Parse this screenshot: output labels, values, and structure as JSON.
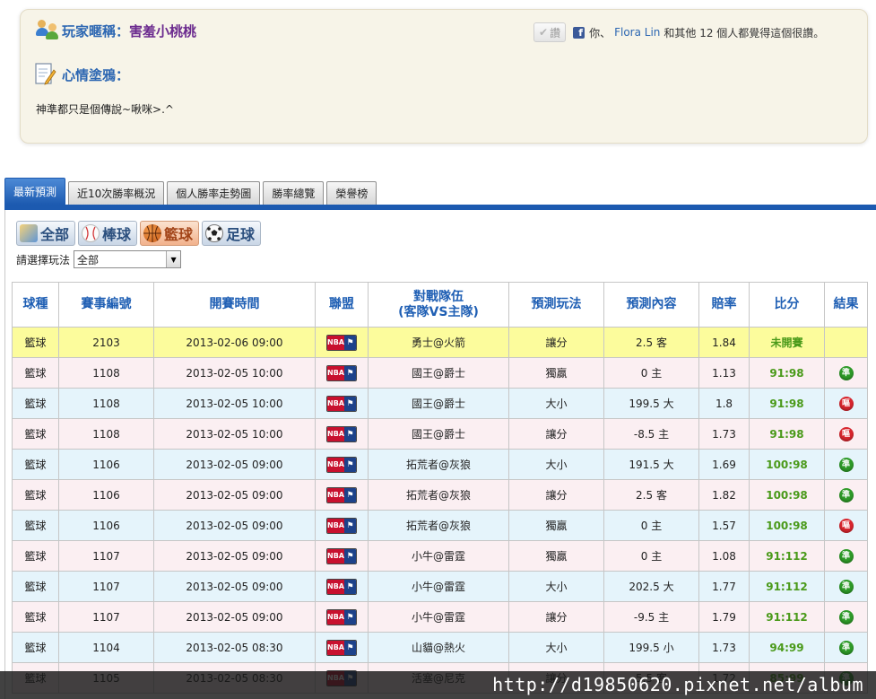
{
  "profile": {
    "nickname_label": "玩家暱稱：",
    "nickname": "害羞小桃桃",
    "mood_label": "心情塗鴉：",
    "mood_text": "神準都只是個傳說~啾咪>.^",
    "like_button": "讚",
    "like_text_you": "你、",
    "like_name": "Flora Lin",
    "like_text_rest": "和其他 12 個人都覺得這個很讚。"
  },
  "tabs": [
    {
      "label": "最新預測",
      "active": true
    },
    {
      "label": "近10次勝率概況",
      "active": false
    },
    {
      "label": "個人勝率走勢圖",
      "active": false
    },
    {
      "label": "勝率總覽",
      "active": false
    },
    {
      "label": "榮譽榜",
      "active": false
    }
  ],
  "sports": [
    {
      "label": "全部",
      "icon": "all-sports-icon",
      "active": false
    },
    {
      "label": "棒球",
      "icon": "baseball-icon",
      "active": false
    },
    {
      "label": "籃球",
      "icon": "basketball-icon",
      "active": true
    },
    {
      "label": "足球",
      "icon": "soccer-icon",
      "active": false
    }
  ],
  "filter": {
    "label": "請選擇玩法",
    "selected": "全部"
  },
  "table": {
    "headers": [
      "球種",
      "賽事編號",
      "開賽時間",
      "聯盟",
      "對戰隊伍",
      "(客隊VS主隊)",
      "預測玩法",
      "預測內容",
      "賠率",
      "比分",
      "結果"
    ],
    "league_logo": {
      "left": "NBA",
      "right": "⚑"
    },
    "result_labels": {
      "win": "準",
      "lose": "嘔"
    },
    "rows": [
      {
        "sport": "籃球",
        "id": "2103",
        "time": "2013-02-06 09:00",
        "match": "勇士@火箭",
        "play": "讓分",
        "pick": "2.5 客",
        "odds": "1.84",
        "score": "未開賽",
        "result": "",
        "style": "hl"
      },
      {
        "sport": "籃球",
        "id": "1108",
        "time": "2013-02-05 10:00",
        "match": "國王@爵士",
        "play": "獨贏",
        "pick": "0 主",
        "odds": "1.13",
        "score": "91:98",
        "result": "win",
        "style": "pink"
      },
      {
        "sport": "籃球",
        "id": "1108",
        "time": "2013-02-05 10:00",
        "match": "國王@爵士",
        "play": "大小",
        "pick": "199.5 大",
        "odds": "1.8",
        "score": "91:98",
        "result": "lose",
        "style": "blue"
      },
      {
        "sport": "籃球",
        "id": "1108",
        "time": "2013-02-05 10:00",
        "match": "國王@爵士",
        "play": "讓分",
        "pick": "-8.5 主",
        "odds": "1.73",
        "score": "91:98",
        "result": "lose",
        "style": "pink"
      },
      {
        "sport": "籃球",
        "id": "1106",
        "time": "2013-02-05 09:00",
        "match": "拓荒者@灰狼",
        "play": "大小",
        "pick": "191.5 大",
        "odds": "1.69",
        "score": "100:98",
        "result": "win",
        "style": "blue"
      },
      {
        "sport": "籃球",
        "id": "1106",
        "time": "2013-02-05 09:00",
        "match": "拓荒者@灰狼",
        "play": "讓分",
        "pick": "2.5 客",
        "odds": "1.82",
        "score": "100:98",
        "result": "win",
        "style": "pink"
      },
      {
        "sport": "籃球",
        "id": "1106",
        "time": "2013-02-05 09:00",
        "match": "拓荒者@灰狼",
        "play": "獨贏",
        "pick": "0 主",
        "odds": "1.57",
        "score": "100:98",
        "result": "lose",
        "style": "blue"
      },
      {
        "sport": "籃球",
        "id": "1107",
        "time": "2013-02-05 09:00",
        "match": "小牛@雷霆",
        "play": "獨贏",
        "pick": "0 主",
        "odds": "1.08",
        "score": "91:112",
        "result": "win",
        "style": "pink"
      },
      {
        "sport": "籃球",
        "id": "1107",
        "time": "2013-02-05 09:00",
        "match": "小牛@雷霆",
        "play": "大小",
        "pick": "202.5 大",
        "odds": "1.77",
        "score": "91:112",
        "result": "win",
        "style": "blue"
      },
      {
        "sport": "籃球",
        "id": "1107",
        "time": "2013-02-05 09:00",
        "match": "小牛@雷霆",
        "play": "讓分",
        "pick": "-9.5 主",
        "odds": "1.79",
        "score": "91:112",
        "result": "win",
        "style": "pink"
      },
      {
        "sport": "籃球",
        "id": "1104",
        "time": "2013-02-05 08:30",
        "match": "山貓@熱火",
        "play": "大小",
        "pick": "199.5 小",
        "odds": "1.73",
        "score": "94:99",
        "result": "win",
        "style": "blue"
      },
      {
        "sport": "籃球",
        "id": "1105",
        "time": "2013-02-05 08:30",
        "match": "活塞@尼克",
        "play": "讓分",
        "pick": "5.5 客",
        "odds": "1.72",
        "score": "85:99",
        "result": "win",
        "style": "pink"
      }
    ]
  },
  "colors": {
    "win": "#2e9a28",
    "lose": "#d8262e",
    "accent": "#1c5ab0"
  },
  "watermark": "http://d19850620.pixnet.net/album"
}
